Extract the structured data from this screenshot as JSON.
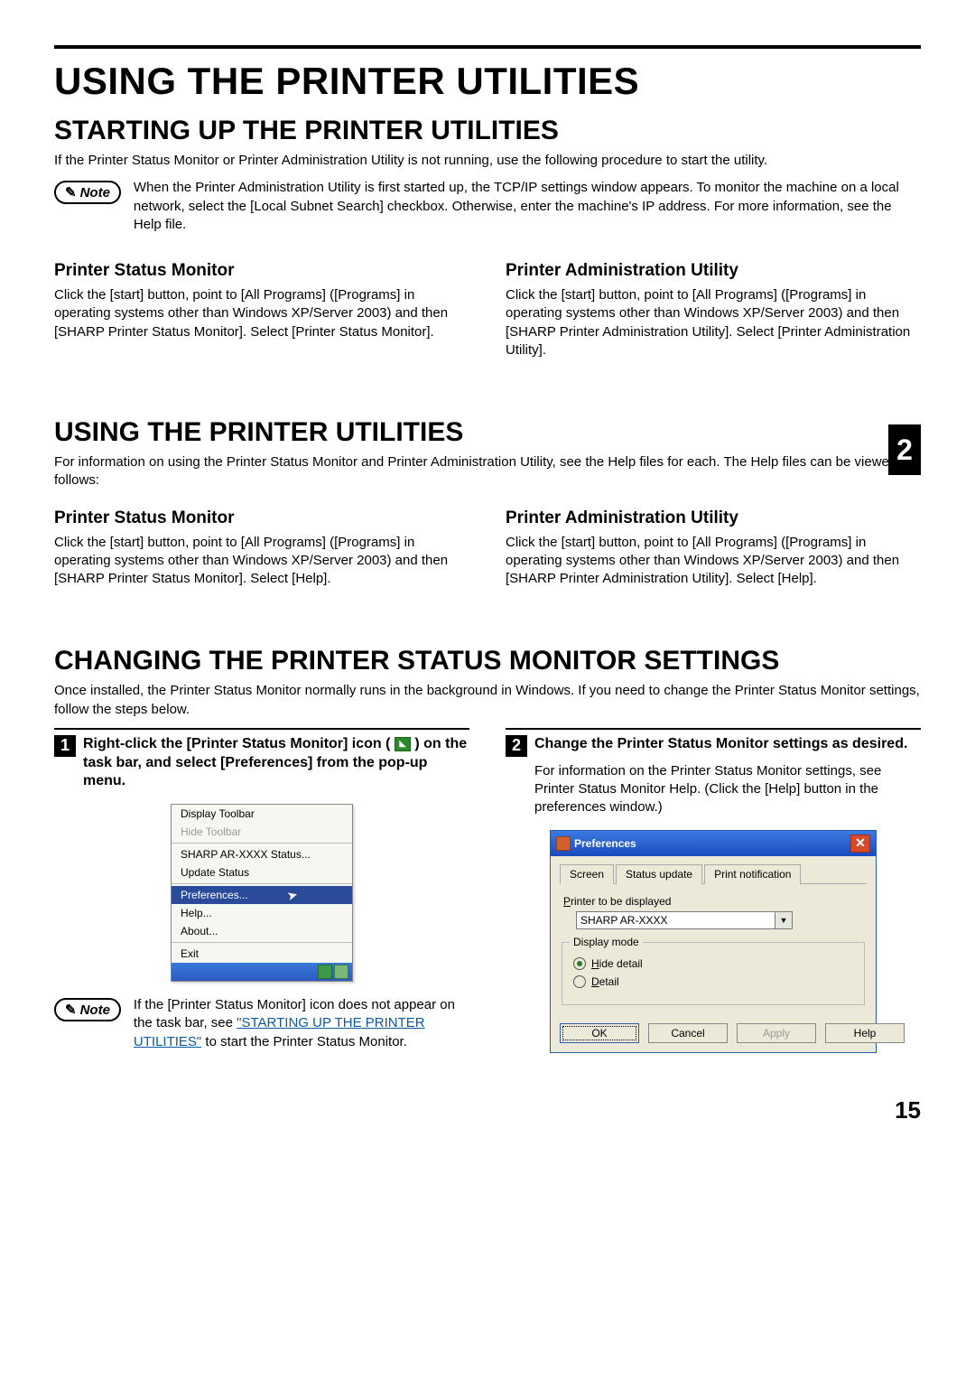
{
  "page_number": "15",
  "chapter_tab": "2",
  "h1": "USING THE PRINTER UTILITIES",
  "sec1": {
    "h2": "STARTING UP THE PRINTER UTILITIES",
    "intro": "If the Printer Status Monitor or Printer Administration Utility is not running, use the following procedure to start the utility.",
    "note_label": "Note",
    "note_text": "When the Printer Administration Utility is first started up, the TCP/IP settings window appears. To monitor the machine on a local network, select the [Local Subnet Search] checkbox. Otherwise, enter the machine's IP address. For more information, see the Help file.",
    "left_h3": "Printer Status Monitor",
    "left_body": "Click the [start] button, point to [All Programs] ([Programs] in operating systems other than Windows XP/Server 2003) and then [SHARP Printer Status Monitor]. Select [Printer Status Monitor].",
    "right_h3": "Printer Administration Utility",
    "right_body": "Click the [start] button, point to [All Programs] ([Programs] in operating systems other than Windows XP/Server 2003) and then [SHARP Printer Administration Utility]. Select [Printer Administration Utility]."
  },
  "sec2": {
    "h2": "USING THE PRINTER UTILITIES",
    "intro": "For information on using the Printer Status Monitor and Printer Administration Utility, see the Help files for each. The Help files can be viewed as follows:",
    "left_h3": "Printer Status Monitor",
    "left_body": "Click the [start] button, point to [All Programs] ([Programs] in operating systems other than Windows XP/Server 2003) and then [SHARP Printer Status Monitor]. Select [Help].",
    "right_h3": "Printer Administration Utility",
    "right_body": "Click the [start] button, point to [All Programs] ([Programs] in operating systems other than Windows XP/Server 2003) and then [SHARP Printer Administration Utility]. Select [Help]."
  },
  "sec3": {
    "h2": "CHANGING THE PRINTER STATUS MONITOR SETTINGS",
    "intro": "Once installed, the Printer Status Monitor normally runs in the background in Windows. If you need to change the Printer Status Monitor settings, follow the steps below.",
    "step1_num": "1",
    "step1_title_a": "Right-click the [Printer Status Monitor] icon (",
    "step1_title_b": ") on the task bar, and select [Preferences] from the pop-up menu.",
    "step2_num": "2",
    "step2_title": "Change the Printer Status Monitor settings as desired.",
    "step2_body": "For information on the Printer Status Monitor settings, see Printer Status Monitor Help. (Click the [Help] button in the preferences window.)",
    "note2_label": "Note",
    "note2_text_a": "If the [Printer Status Monitor] icon does not appear on the task bar, see ",
    "note2_link": "\"STARTING UP THE PRINTER UTILITIES\"",
    "note2_text_b": " to start the Printer Status Monitor."
  },
  "context_menu": {
    "display_toolbar": "Display Toolbar",
    "hide_toolbar": "Hide Toolbar",
    "status": "SHARP AR-XXXX Status...",
    "update": "Update Status",
    "preferences": "Preferences...",
    "help": "Help...",
    "about": "About...",
    "exit": "Exit"
  },
  "pref_dialog": {
    "title": "Preferences",
    "tabs": {
      "screen": "Screen",
      "status_update": "Status update",
      "print_notif": "Print notification"
    },
    "printer_label_a": "P",
    "printer_label_b": "rinter to be displayed",
    "printer_value": "SHARP AR-XXXX",
    "display_mode": "Display mode",
    "hide_a": "H",
    "hide_b": "ide detail",
    "detail_a": "D",
    "detail_b": "etail",
    "ok": "OK",
    "cancel": "Cancel",
    "apply": "Apply",
    "help": "Help"
  }
}
